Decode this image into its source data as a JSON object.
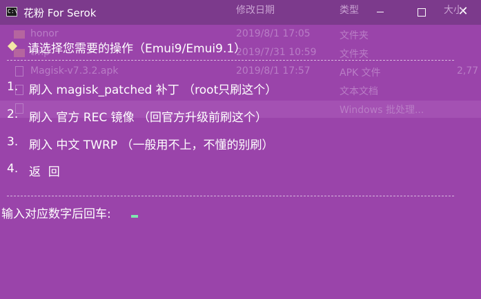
{
  "window": {
    "title": "花粉 For Serok",
    "icon_text": "C:\\",
    "icons": {
      "app": "console-icon",
      "min": "minimize-icon",
      "max": "maximize-icon",
      "close": "close-icon"
    },
    "close_glyph": "✕"
  },
  "background_explorer": {
    "headers": {
      "modified": "修改日期",
      "type": "类型",
      "size": "大小"
    },
    "rows": [
      {
        "name": "honor",
        "modified": "2019/8/1 17:05",
        "type": "文件夹",
        "size": ""
      },
      {
        "name": "tmp",
        "modified": "2019/7/31 10:59",
        "type": "文件夹",
        "size": ""
      },
      {
        "name": "Magisk-v7.3.2.apk",
        "modified": "2019/8/1 17:57",
        "type": "APK 文件",
        "size": "2,77"
      },
      {
        "name": "",
        "modified": "",
        "type": "文本文档",
        "size": ""
      },
      {
        "name": "",
        "modified": "",
        "type": "Windows 批处理...",
        "size": ""
      }
    ]
  },
  "console": {
    "prompt_heading": "请选择您需要的操作（Emui9/Emui9.1）",
    "options": [
      {
        "num": "1.",
        "text": "刷入 magisk_patched 补丁 （root只刷这个）"
      },
      {
        "num": "2.",
        "text": "刷入 官方 REC 镜像 （回官方升级前刷这个）"
      },
      {
        "num": "3.",
        "text": "刷入 中文 TWRP （一般用不上，不懂的别刷）"
      },
      {
        "num": "4.",
        "text": "返  回"
      }
    ],
    "input_prompt": "输入对应数字后回车:",
    "colors": {
      "background": "#9a44aa",
      "text": "#ffffff",
      "cursor": "#7fe6b0",
      "bullet": "#f3e6a6"
    }
  }
}
